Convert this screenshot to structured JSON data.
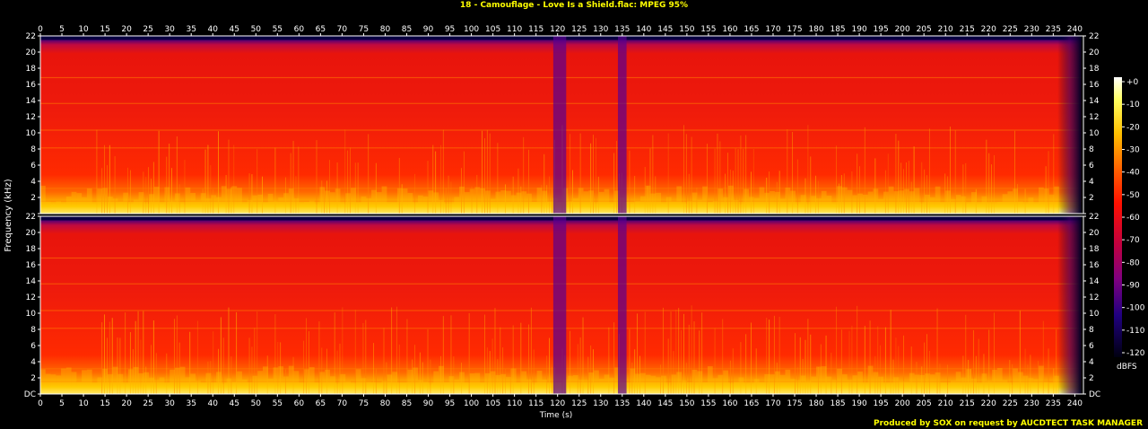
{
  "title": "18 - Camouflage - Love Is a Shield.flac: MPEG 95%",
  "footer": "Produced by SOX on request by AUCDTECT TASK MANAGER",
  "colors": {
    "title": "#ffff00",
    "footer": "#ffff00",
    "background": "#000000",
    "axis": "#ffffff"
  },
  "chart_data": {
    "type": "heatmap",
    "title": "18 - Camouflage - Love Is a Shield.flac: MPEG 95%",
    "xlabel": "Time (s)",
    "ylabel": "Frequency (kHz)",
    "channels": 2,
    "x_ticks": [
      0,
      5,
      10,
      15,
      20,
      25,
      30,
      35,
      40,
      45,
      50,
      55,
      60,
      65,
      70,
      75,
      80,
      85,
      90,
      95,
      100,
      105,
      110,
      115,
      120,
      125,
      130,
      135,
      140,
      145,
      150,
      155,
      160,
      165,
      170,
      175,
      180,
      185,
      190,
      195,
      200,
      205,
      210,
      215,
      220,
      225,
      230,
      235,
      240
    ],
    "y_ticks": [
      "DC",
      "2",
      "4",
      "6",
      "8",
      "10",
      "12",
      "14",
      "16",
      "18",
      "20",
      "22"
    ],
    "xlim": [
      0,
      242
    ],
    "ylim": [
      0,
      22
    ],
    "colorbar": {
      "label": "dBFS",
      "ticks": [
        "+0",
        "-10",
        "-20",
        "-30",
        "-40",
        "-50",
        "-60",
        "-70",
        "-80",
        "-90",
        "-100",
        "-110",
        "-120"
      ],
      "range": [
        -120,
        0
      ]
    },
    "features": {
      "cutoff_khz": 21.5,
      "quiet_segments_s": [
        [
          119,
          122
        ],
        [
          134,
          136
        ]
      ],
      "fadeout_start_s": 236,
      "end_s": 241.5
    }
  }
}
